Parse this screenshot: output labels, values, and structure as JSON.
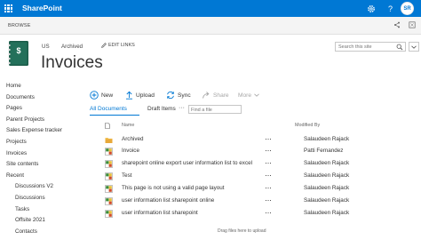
{
  "suite": {
    "brand": "SharePoint",
    "avatar_initials": "SR",
    "icons": [
      "waffle-icon",
      "settings-icon",
      "help-icon"
    ],
    "help_glyph": "?",
    "accent_color": "#0078d4"
  },
  "ribbon": {
    "tab_label": "BROWSE",
    "icons": [
      "share-icon",
      "focus-icon"
    ]
  },
  "site": {
    "breadcrumb": [
      "US",
      "Archived"
    ],
    "edit_links_label": "EDIT LINKS",
    "title": "Invoices",
    "search_placeholder": "Search this site"
  },
  "quicklaunch": {
    "items": [
      {
        "label": "Home",
        "sub": false
      },
      {
        "label": "Documents",
        "sub": false
      },
      {
        "label": "Pages",
        "sub": false
      },
      {
        "label": "Parent Projects",
        "sub": false
      },
      {
        "label": "Sales Expense tracker",
        "sub": false
      },
      {
        "label": "Projects",
        "sub": false
      },
      {
        "label": "Invoices",
        "sub": false
      },
      {
        "label": "Site contents",
        "sub": false
      },
      {
        "label": "Recent",
        "sub": false
      },
      {
        "label": "Discussions V2",
        "sub": true
      },
      {
        "label": "Discussions",
        "sub": true
      },
      {
        "label": "Tasks",
        "sub": true
      },
      {
        "label": "Offsite 2021",
        "sub": true
      },
      {
        "label": "Contacts",
        "sub": true
      }
    ]
  },
  "commands": {
    "new_label": "New",
    "upload_label": "Upload",
    "sync_label": "Sync",
    "share_label": "Share",
    "more_label": "More"
  },
  "views": {
    "all_documents": "All Documents",
    "draft_items": "Draft Items",
    "more_glyph": "···",
    "find_placeholder": "Find a file"
  },
  "list": {
    "col_name": "Name",
    "col_modified_by": "Modified By",
    "more_glyph": "···",
    "rows": [
      {
        "name": "Archived",
        "modified_by": "Salaudeen Rajack",
        "type": "folder"
      },
      {
        "name": "Invoice",
        "modified_by": "Patti Fernandez",
        "type": "link"
      },
      {
        "name": "sharepoint online export user information list to excel",
        "modified_by": "Salaudeen Rajack",
        "type": "link"
      },
      {
        "name": "Test",
        "modified_by": "Salaudeen Rajack",
        "type": "link"
      },
      {
        "name": "This page is not using a valid page layout",
        "modified_by": "Salaudeen Rajack",
        "type": "link"
      },
      {
        "name": "user information list sharepoint online",
        "modified_by": "Salaudeen Rajack",
        "type": "link"
      },
      {
        "name": "user information list sharepoint",
        "modified_by": "Salaudeen Rajack",
        "type": "link"
      }
    ],
    "drag_hint": "Drag files here to upload"
  }
}
